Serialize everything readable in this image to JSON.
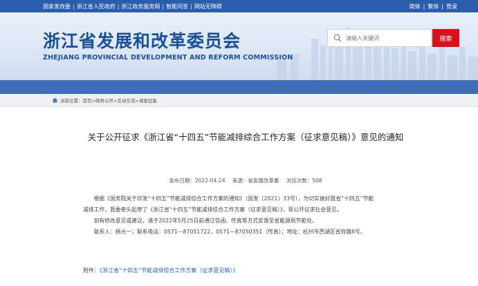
{
  "topbar": {
    "links": [
      "国家发改委",
      "浙江省人民政府",
      "浙江政务服务网",
      "智能问答",
      "网站无障碍"
    ],
    "right": [
      "简体",
      "繁体",
      "登录"
    ]
  },
  "header": {
    "title_cn": "浙江省发展和改革委员会",
    "title_en": "ZHEJIANG PROVINCIAL DEVELOPMENT AND REFORM COMMISSION",
    "search_placeholder": "请输入关键词",
    "search_button": "搜索"
  },
  "breadcrumb": {
    "text": "当前位置：首页>政务公开>互动交流>调查征集"
  },
  "article": {
    "title": "关于公开征求《浙江省“十四五”节能减排综合工作方案（征求意见稿）》意见的通知",
    "date": "发布日期：2022-04-24",
    "source": "来源：省发展改革委",
    "views": "浏览次数：508",
    "para1": "根据《国务院关于印发“十四五”节能减排综合工作方案的通知》（国发〔2021〕33号），为切实做好我省“十四五”节能减排工作，我委牵头起草了《浙江省“十四五”节能减排综合工作方案（征求意见稿）》，现公开征求社会意见。",
    "para2": "如有修改意见或建议，请于2022年5月25日前通过信函、传真等方式反馈至省能源局节能处。",
    "para3": "联系人：杨元一；联系电话：0571—87051722，0571—87050351（传真）；地址：杭州市西湖区省府路8号。",
    "attach_label": "附件：",
    "attach_link": "《浙江省“十四五”节能减排综合工作方案（征求意见稿）》"
  },
  "colors": {
    "topbar": "#2a5dab",
    "band": "#3d6eb7",
    "logo": "#1a4f9c",
    "search_button": "#d9121a",
    "link": "#2b5db5"
  },
  "icons": [
    "search-icon",
    "home-icon"
  ]
}
